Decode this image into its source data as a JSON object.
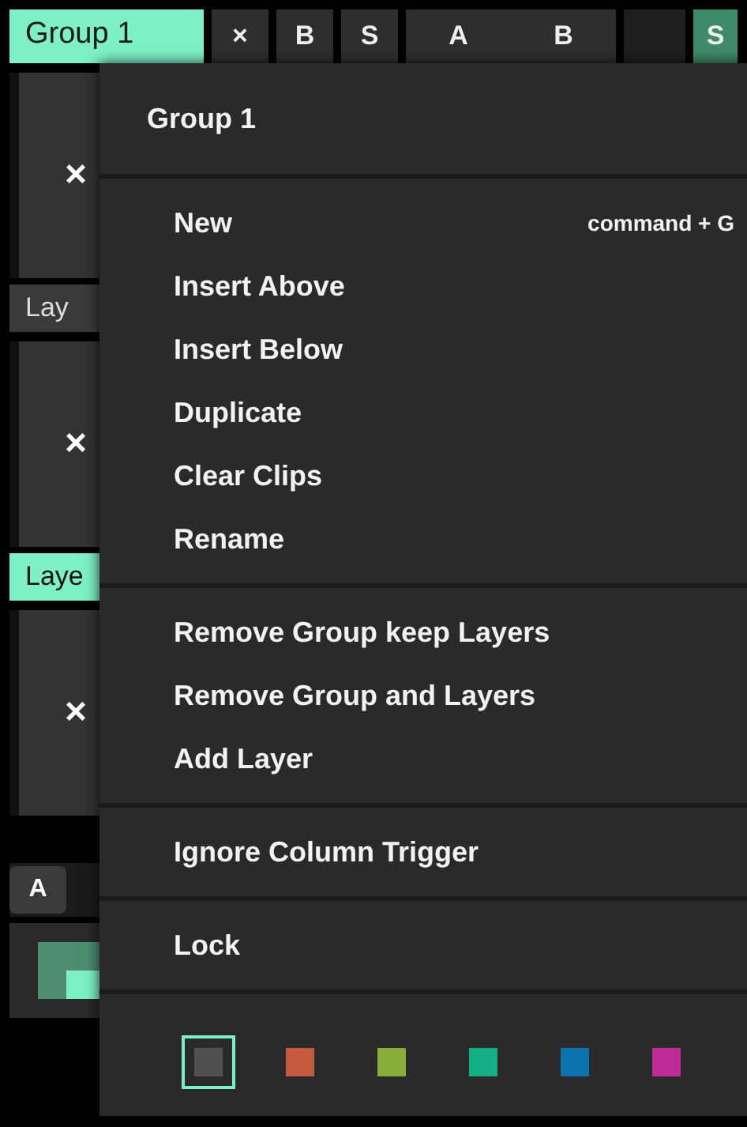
{
  "top_bar": [
    {
      "label": "Group 1",
      "kind": "group-tab"
    },
    {
      "label": "×",
      "kind": "button"
    },
    {
      "label": "B",
      "kind": "button"
    },
    {
      "label": "S",
      "kind": "button"
    },
    {
      "label": "A",
      "kind": "ab"
    },
    {
      "kind": "blank"
    },
    {
      "label": "S",
      "kind": "active"
    }
  ],
  "top_bar_b": "B",
  "left_column": [
    {
      "kind": "clip",
      "label": "×"
    },
    {
      "kind": "layer",
      "label": "Lay",
      "selected": false
    },
    {
      "kind": "clip",
      "label": "×"
    },
    {
      "kind": "layer",
      "label": "Laye",
      "selected": true
    },
    {
      "kind": "clip",
      "label": "×"
    },
    {
      "kind": "button",
      "label": "A"
    },
    {
      "kind": "thumb"
    }
  ],
  "menu": {
    "title": "Group 1",
    "sections": [
      [
        {
          "label": "New",
          "shortcut": "command + G"
        },
        {
          "label": "Insert Above"
        },
        {
          "label": "Insert Below"
        },
        {
          "label": "Duplicate"
        },
        {
          "label": "Clear Clips"
        },
        {
          "label": "Rename"
        }
      ],
      [
        {
          "label": "Remove Group keep Layers"
        },
        {
          "label": "Remove Group and Layers"
        },
        {
          "label": "Add Layer"
        }
      ],
      [
        {
          "label": "Ignore Column Trigger"
        }
      ],
      [
        {
          "label": "Lock"
        }
      ]
    ],
    "swatches": [
      {
        "color": "#505050",
        "selected": true
      },
      {
        "color": "#c45a3e",
        "selected": false
      },
      {
        "color": "#86ad3a",
        "selected": false
      },
      {
        "color": "#13b085",
        "selected": false
      },
      {
        "color": "#0d73ad",
        "selected": false
      },
      {
        "color": "#c02b98",
        "selected": false
      }
    ]
  }
}
